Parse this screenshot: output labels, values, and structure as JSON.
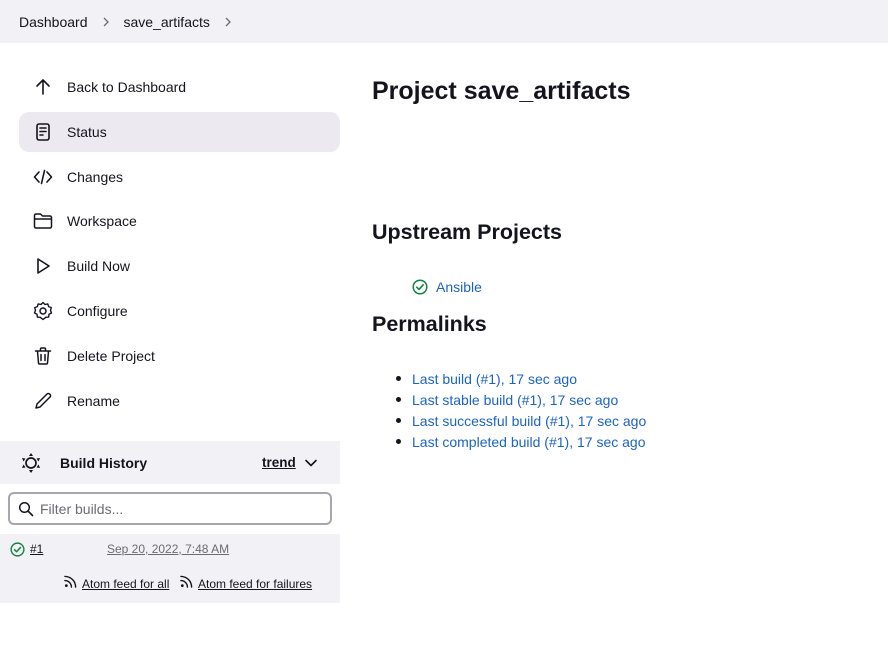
{
  "breadcrumb": {
    "items": [
      "Dashboard",
      "save_artifacts"
    ]
  },
  "sidebar": {
    "items": [
      {
        "label": "Back to Dashboard",
        "icon": "arrow-up-icon"
      },
      {
        "label": "Status",
        "icon": "document-icon",
        "active": true
      },
      {
        "label": "Changes",
        "icon": "code-icon"
      },
      {
        "label": "Workspace",
        "icon": "folder-icon"
      },
      {
        "label": "Build Now",
        "icon": "play-icon"
      },
      {
        "label": "Configure",
        "icon": "gear-icon"
      },
      {
        "label": "Delete Project",
        "icon": "trash-icon"
      },
      {
        "label": "Rename",
        "icon": "pencil-icon"
      }
    ]
  },
  "build_history": {
    "title": "Build History",
    "trend_label": "trend",
    "filter_placeholder": "Filter builds...",
    "builds": [
      {
        "number": "#1",
        "time": "Sep 20, 2022, 7:48 AM",
        "status": "success"
      }
    ],
    "feed_all": "Atom feed for all",
    "feed_failures": "Atom feed for failures"
  },
  "main": {
    "title": "Project save_artifacts",
    "upstream_heading": "Upstream Projects",
    "upstream": [
      {
        "name": "Ansible",
        "status": "success"
      }
    ],
    "permalinks_heading": "Permalinks",
    "permalinks": [
      "Last build (#1), 17 sec ago",
      "Last stable build (#1), 17 sec ago",
      "Last successful build (#1), 17 sec ago",
      "Last completed build (#1), 17 sec ago"
    ]
  },
  "colors": {
    "link": "#1c63c7",
    "success": "#138347",
    "panel_bg": "#f2f1f5",
    "active_bg": "#eceaf0"
  }
}
